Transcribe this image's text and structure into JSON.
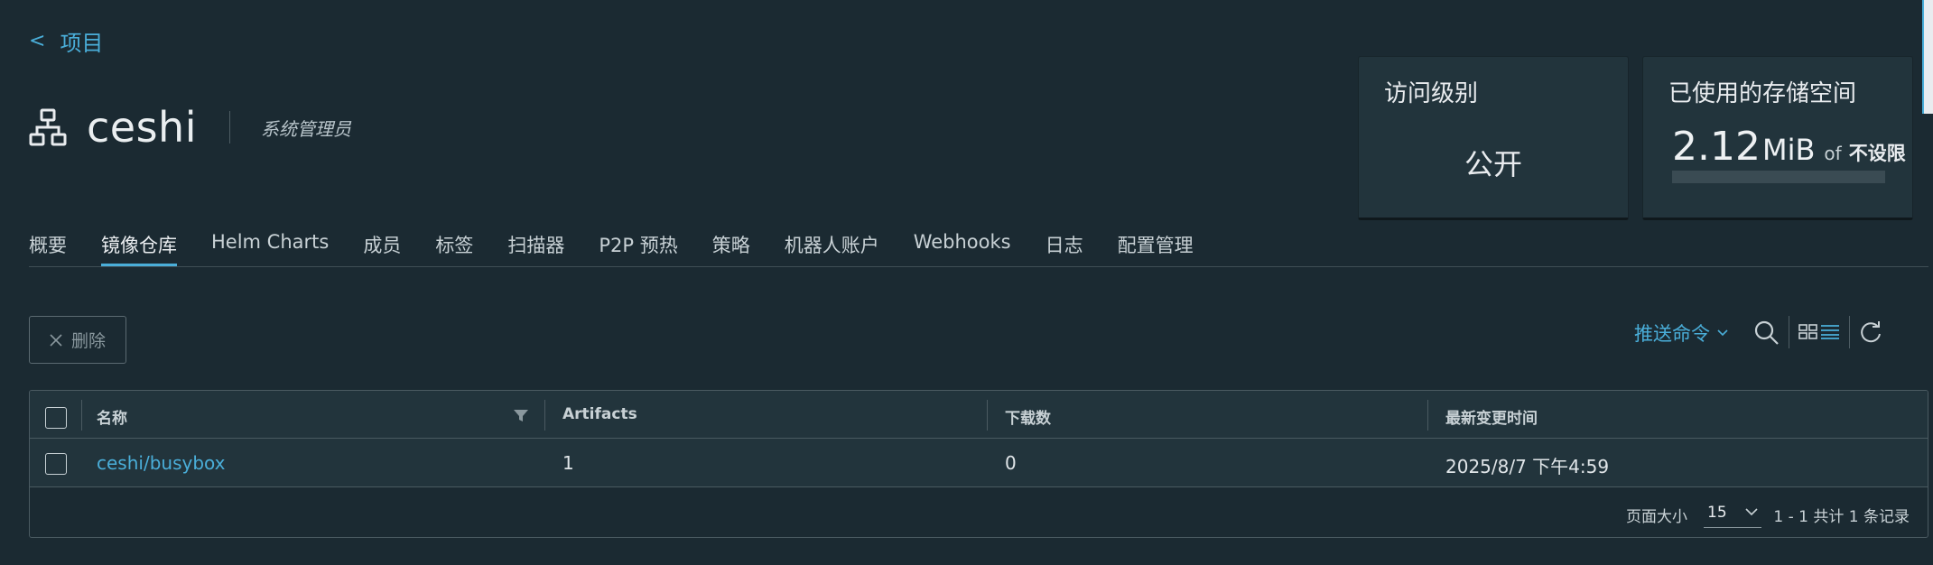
{
  "breadcrumb": {
    "back_symbol": "<",
    "label": "项目"
  },
  "project": {
    "name": "ceshi",
    "role": "系统管理员"
  },
  "cards": {
    "access": {
      "title": "访问级别",
      "value": "公开"
    },
    "storage": {
      "title": "已使用的存储空间",
      "used": "2.12",
      "unit": "MiB",
      "of": "of",
      "limit": "不设限",
      "used_fraction": 0.0
    }
  },
  "tabs": [
    {
      "label": "概要",
      "active": false
    },
    {
      "label": "镜像仓库",
      "active": true
    },
    {
      "label": "Helm Charts",
      "active": false
    },
    {
      "label": "成员",
      "active": false
    },
    {
      "label": "标签",
      "active": false
    },
    {
      "label": "扫描器",
      "active": false
    },
    {
      "label": "P2P 预热",
      "active": false
    },
    {
      "label": "策略",
      "active": false
    },
    {
      "label": "机器人账户",
      "active": false
    },
    {
      "label": "Webhooks",
      "active": false
    },
    {
      "label": "日志",
      "active": false
    },
    {
      "label": "配置管理",
      "active": false
    }
  ],
  "toolbar": {
    "delete_label": "删除",
    "push_label": "推送命令"
  },
  "table": {
    "columns": [
      "名称",
      "Artifacts",
      "下载数",
      "最新变更时间"
    ],
    "rows": [
      {
        "name": "ceshi/busybox",
        "artifacts": "1",
        "downloads": "0",
        "updated": "2025/8/7 下午4:59"
      }
    ],
    "footer": {
      "page_size_label": "页面大小",
      "page_size": "15",
      "pagination": "1 - 1 共计 1 条记录"
    }
  },
  "colors": {
    "background": "#1b2a32",
    "panel": "#22343c",
    "accent": "#4aaed9"
  }
}
